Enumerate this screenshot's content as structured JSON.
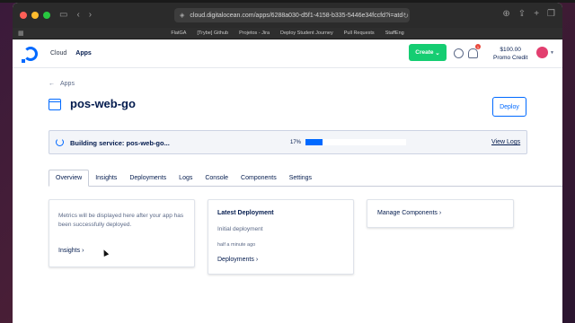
{
  "browser": {
    "url": "cloud.digitalocean.com/apps/6288a030-d5f1-4158-b335-5446e34fccfd?i=atd",
    "favorites": [
      "FlatGA",
      "[Trybe] Github",
      "Projetos - Jira",
      "Deploy Student Journey",
      "Pull Requests",
      "StaffEng"
    ]
  },
  "nav": {
    "cloud": "Cloud",
    "apps": "Apps",
    "create": "Create",
    "notification_count": "1",
    "credit_amount": "$100.00",
    "credit_label": "Promo Credit"
  },
  "page": {
    "back": "Apps",
    "title": "pos-web-go",
    "deploy": "Deploy"
  },
  "build": {
    "status": "Building service: pos-web-go...",
    "percent": "17%",
    "progress": 0.17,
    "view_logs": "View Logs"
  },
  "tabs": [
    "Overview",
    "Insights",
    "Deployments",
    "Logs",
    "Console",
    "Components",
    "Settings"
  ],
  "cards": {
    "metrics": {
      "text": "Metrics will be displayed here after your app has been successfully deployed.",
      "link": "Insights"
    },
    "deployment": {
      "title": "Latest Deployment",
      "text": "Initial deployment",
      "time": "half a minute ago",
      "link": "Deployments"
    },
    "components": {
      "link": "Manage Components"
    }
  },
  "colors": {
    "primary": "#0069ff",
    "create": "#15cd72",
    "heading": "#031b4e"
  }
}
